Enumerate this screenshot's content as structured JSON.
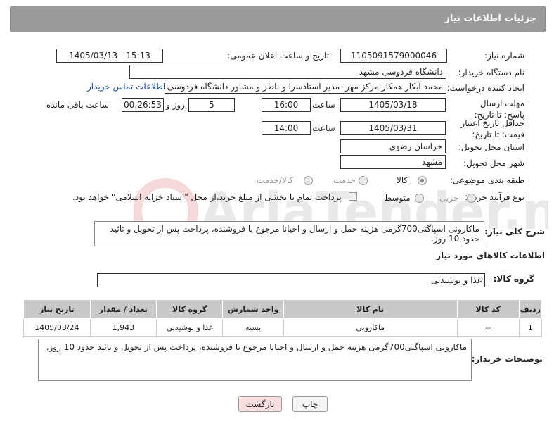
{
  "header": {
    "title": "جزئیات اطلاعات نیاز"
  },
  "fields": {
    "need_number_label": "شماره نیاز:",
    "need_number": "1105091579000046",
    "announce_label": "تاریخ و ساعت اعلان عمومی:",
    "announce_value": "1405/03/13 - 15:13",
    "buyer_org_label": "نام دستگاه خریدار:",
    "buyer_org": "دانشگاه فردوسی مشهد",
    "creator_label": "ایجاد کننده درخواست:",
    "creator": "محمد آبکار همکار مرکز مهر- مدیر استادسرا و ناظر و مشاور دانشگاه فردوسی مشهد",
    "contact_link": "اطلاعات تماس خریدار",
    "deadline_label": "مهلت ارسال پاسخ: تا تاریخ:",
    "deadline_date": "1405/03/18",
    "time_word": "ساعت",
    "deadline_time": "16:00",
    "days_value": "5",
    "days_word": "روز و",
    "remaining_time": "00:26:53",
    "remaining_word": "ساعت باقی مانده",
    "validity_label": "حداقل تاریخ اعتبار قیمت: تا تاریخ:",
    "validity_date": "1405/03/31",
    "validity_time": "14:00",
    "province_label": "استان محل تحویل:",
    "province": "خراسان رضوی",
    "city_label": "شهر محل تحویل:",
    "city": "مشهد",
    "category_label": "طبقه بندی موضوعی:",
    "category_options": [
      "کالا",
      "خدمت",
      "کالا/خدمت"
    ],
    "process_label": "نوع فرآیند خرید :",
    "process_options": [
      "جزیی",
      "متوسط"
    ],
    "payment_note": "پرداخت تمام یا بخشی از مبلغ خرید،از محل \"اسناد خزانه اسلامی\" خواهد بود."
  },
  "description": {
    "label": "شرح کلی نیاز:",
    "text": "ماکارونی اسپاگتی700گرمی  هزینه حمل و ارسال و احیانا مرجوع با فروشنده، پرداخت پس از تحویل و تائید حدود 10 روز."
  },
  "goods": {
    "section_title": "اطلاعات کالاهای مورد نیاز",
    "group_label": "گروه کالا:",
    "group_value": "غذا و نوشیدنی",
    "columns": [
      "ردیف",
      "کد کالا",
      "نام کالا",
      "واحد شمارش",
      "گروه کالا",
      "تعداد / مقدار",
      "تاریخ نیاز"
    ],
    "rows": [
      [
        "1",
        "--",
        "ماکارونی",
        "بسته",
        "غذا و نوشیدنی",
        "1,943",
        "1405/03/24"
      ]
    ]
  },
  "buyer_notes": {
    "label": "توضیحات خریدار:",
    "text": "ماکارونی اسپاگتی700گرمی هزینه حمل و ارسال و احیانا مرجوع با فروشنده، پرداخت پس از تحویل و تائید حدود 10 روز."
  },
  "buttons": {
    "print": "چاپ",
    "back": "بازگشت"
  },
  "watermark": {
    "text": "AriaTender.net"
  },
  "colors": {
    "header_bg": "#9a9a9a",
    "link": "#1a4fa0",
    "back_button_bg": "#f9dede"
  }
}
